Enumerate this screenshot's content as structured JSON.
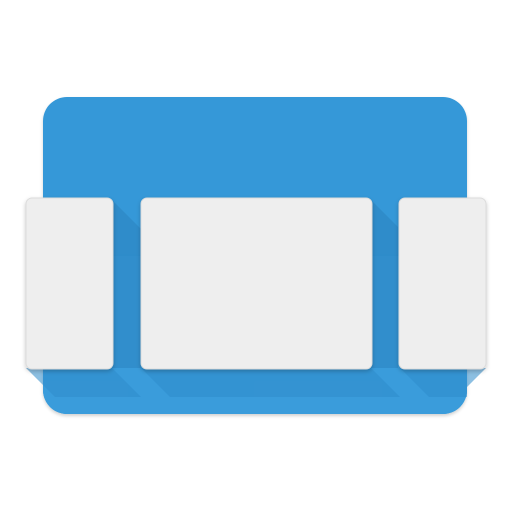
{
  "icon": {
    "name": "carousel-app-icon",
    "colors": {
      "background_blue": "#3498d8",
      "background_blue_light": "#4aa3dd",
      "shadow_blue": "#2a83c0",
      "card_fill": "#eeeeee",
      "card_edge": "#dcdcdc"
    }
  }
}
